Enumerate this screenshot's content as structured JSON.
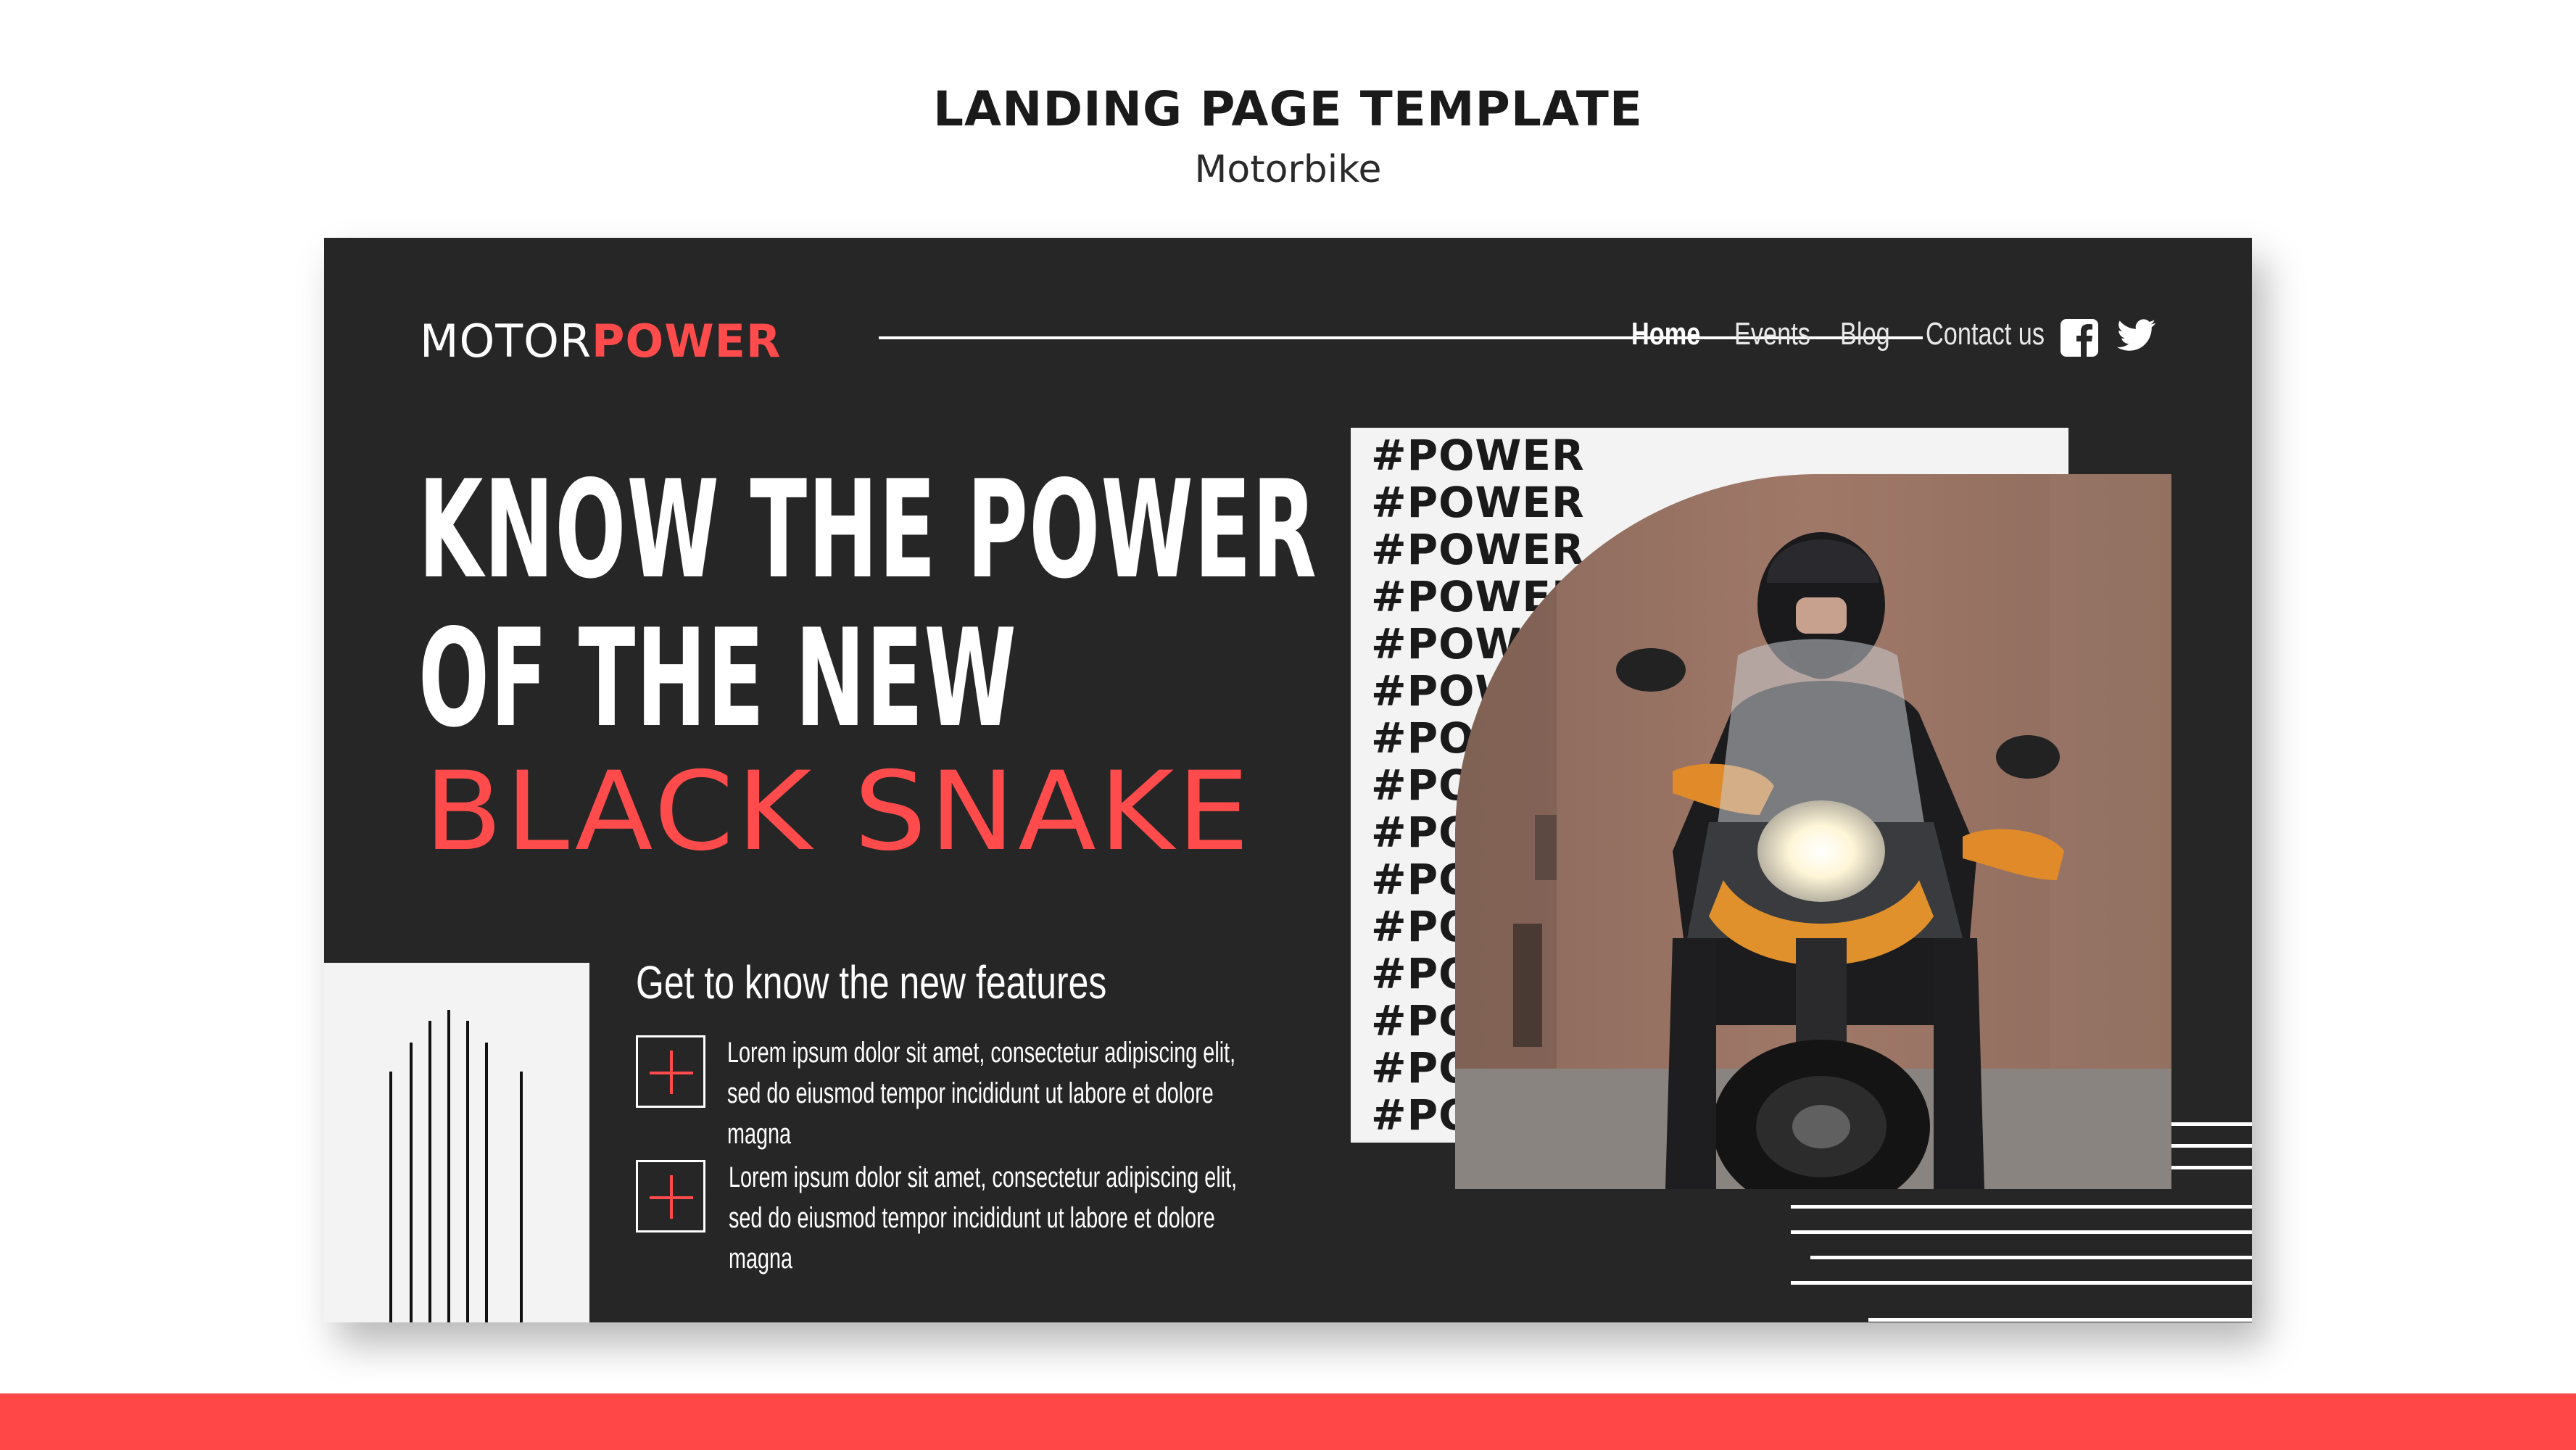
{
  "header": {
    "title": "LANDING PAGE TEMPLATE",
    "subtitle": "Motorbike"
  },
  "brand": {
    "logo_part1": "MOTOR",
    "logo_part2": "POWER",
    "accent_color": "#ff4b4b",
    "dark_color": "#262626"
  },
  "nav": {
    "items": [
      {
        "label": "Home",
        "active": true
      },
      {
        "label": "Events",
        "active": false
      },
      {
        "label": "Blog",
        "active": false
      },
      {
        "label": "Contact us",
        "active": false
      }
    ],
    "social": [
      "facebook-icon",
      "twitter-icon"
    ]
  },
  "hero": {
    "headline_line1": "KNOW THE POWER",
    "headline_line2": "OF THE NEW",
    "headline_accent": "BLACK SNAKE"
  },
  "features": {
    "title": "Get to know the new features",
    "items": [
      {
        "icon": "plus-icon",
        "text": "Lorem ipsum dolor sit amet, consectetur adipiscing elit, sed do eiusmod tempor incididunt ut labore et dolore magna"
      },
      {
        "icon": "plus-icon",
        "text": "Lorem ipsum dolor sit amet, consectetur adipiscing elit, sed do eiusmod tempor incididunt ut labore et dolore magna"
      }
    ]
  },
  "power_tags": [
    "#POWER",
    "#POWER",
    "#POWER",
    "#POWER",
    "#POWER",
    "#POWER",
    "#POWER",
    "#POWER",
    "#POWER",
    "#POWER",
    "#POWER",
    "#POWER",
    "#POWER",
    "#POWER",
    "#POWER"
  ]
}
